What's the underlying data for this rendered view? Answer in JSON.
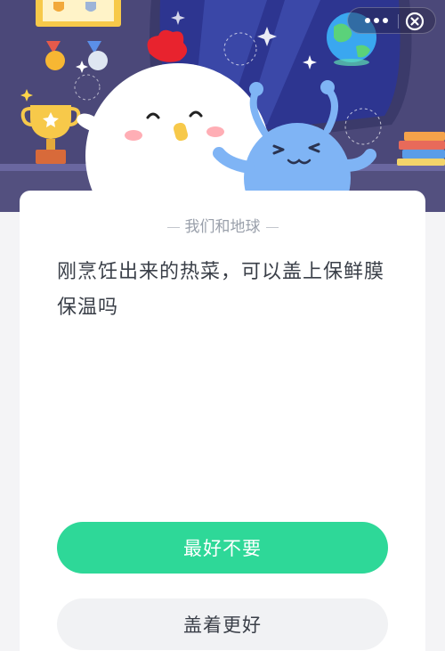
{
  "header": {
    "capsule_more_icon": "more-dots-icon",
    "capsule_close_icon": "close-circle-icon"
  },
  "quiz": {
    "category": "我们和地球",
    "question": "刚烹饪出来的热菜，可以盖上保鲜膜保温吗",
    "options": [
      {
        "label": "最好不要",
        "color": "#2ed898"
      },
      {
        "label": "盖着更好",
        "color": "#f1f2f4"
      }
    ]
  },
  "colors": {
    "hero_bg": "#4a4878",
    "accent": "#2ed898"
  }
}
